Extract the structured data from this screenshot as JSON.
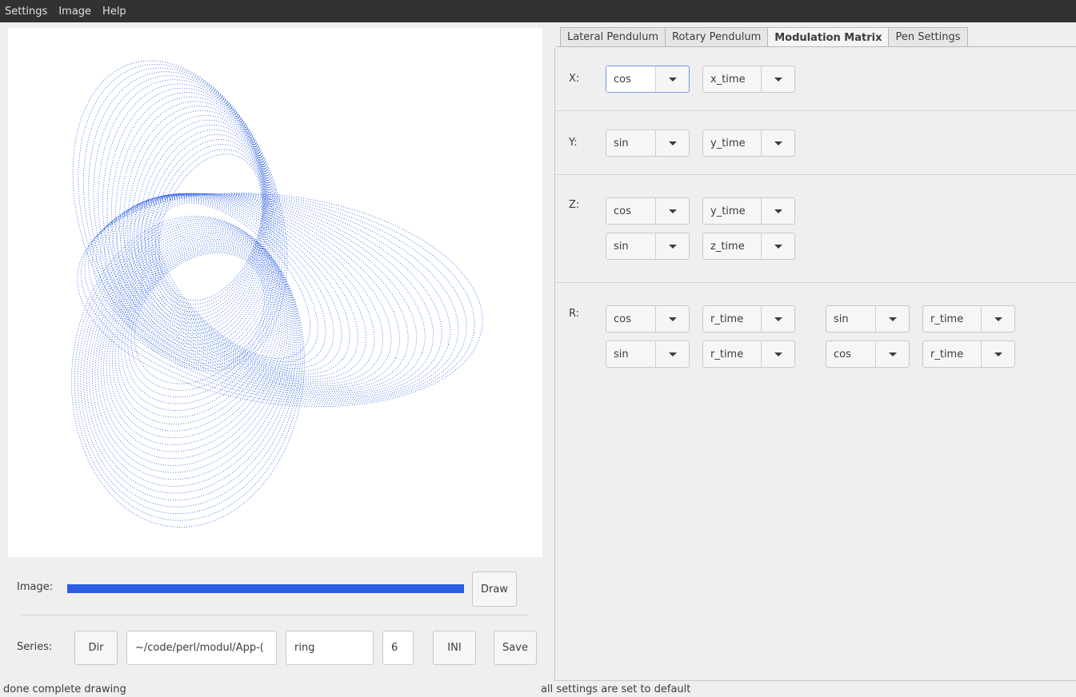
{
  "menubar": {
    "items": [
      "Settings",
      "Image",
      "Help"
    ]
  },
  "canvas": {
    "curve_color": "#2a5de0"
  },
  "image_row": {
    "label": "Image:",
    "progress": 1.0,
    "draw_label": "Draw"
  },
  "series_row": {
    "label": "Series:",
    "dir_label": "Dir",
    "path_value": "~/code/perl/modul/App-(",
    "name_value": "ring",
    "number_value": "6",
    "ini_label": "INI",
    "save_label": "Save"
  },
  "status": {
    "left": "done complete drawing",
    "right": "all settings are set to default"
  },
  "tabs": [
    {
      "label": "Lateral Pendulum",
      "active": false
    },
    {
      "label": "Rotary Pendulum",
      "active": false
    },
    {
      "label": "Modulation Matrix",
      "active": true
    },
    {
      "label": "Pen Settings",
      "active": false
    }
  ],
  "modulation": {
    "x": {
      "label": "X:",
      "fn": "cos",
      "var": "x_time"
    },
    "y": {
      "label": "Y:",
      "fn": "sin",
      "var": "y_time"
    },
    "z": {
      "label": "Z:",
      "rows": [
        {
          "fn": "cos",
          "var": "y_time"
        },
        {
          "fn": "sin",
          "var": "z_time"
        }
      ]
    },
    "r": {
      "label": "R:",
      "rows": [
        {
          "fn": "cos",
          "var": "r_time",
          "fn2": "sin",
          "var2": "r_time"
        },
        {
          "fn": "sin",
          "var": "r_time",
          "fn2": "cos",
          "var2": "r_time"
        }
      ]
    }
  }
}
